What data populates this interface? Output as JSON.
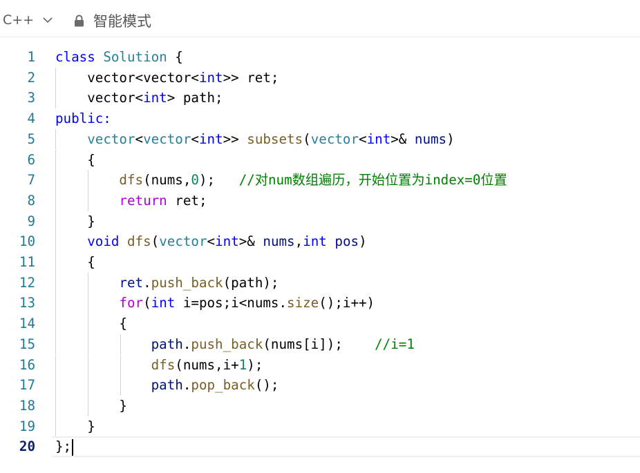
{
  "toolbar": {
    "language": "C++",
    "mode_label": "智能模式"
  },
  "editor": {
    "lines": [
      {
        "n": "1",
        "indent": 0,
        "tokens": [
          {
            "t": "class",
            "c": "#0000ff"
          },
          {
            "t": " "
          },
          {
            "t": "Solution",
            "c": "#267f99"
          },
          {
            "t": " {"
          }
        ]
      },
      {
        "n": "2",
        "indent": 1,
        "tokens": [
          {
            "t": "    vector<vector<"
          },
          {
            "t": "int",
            "c": "#0000ff"
          },
          {
            "t": ">> ret;"
          }
        ]
      },
      {
        "n": "3",
        "indent": 1,
        "tokens": [
          {
            "t": "    vector<"
          },
          {
            "t": "int",
            "c": "#0000ff"
          },
          {
            "t": "> path;"
          }
        ]
      },
      {
        "n": "4",
        "indent": 0,
        "tokens": [
          {
            "t": "public:",
            "c": "#0000ff"
          }
        ]
      },
      {
        "n": "5",
        "indent": 1,
        "tokens": [
          {
            "t": "    "
          },
          {
            "t": "vector",
            "c": "#267f99"
          },
          {
            "t": "<"
          },
          {
            "t": "vector",
            "c": "#267f99"
          },
          {
            "t": "<"
          },
          {
            "t": "int",
            "c": "#0000ff"
          },
          {
            "t": ">> "
          },
          {
            "t": "subsets",
            "c": "#795e26"
          },
          {
            "t": "("
          },
          {
            "t": "vector",
            "c": "#267f99"
          },
          {
            "t": "<"
          },
          {
            "t": "int",
            "c": "#0000ff"
          },
          {
            "t": ">& "
          },
          {
            "t": "nums",
            "c": "#001080"
          },
          {
            "t": ")"
          }
        ]
      },
      {
        "n": "6",
        "indent": 1,
        "tokens": [
          {
            "t": "    {"
          }
        ]
      },
      {
        "n": "7",
        "indent": 2,
        "tokens": [
          {
            "t": "        "
          },
          {
            "t": "dfs",
            "c": "#795e26"
          },
          {
            "t": "(nums,"
          },
          {
            "t": "0",
            "c": "#098658"
          },
          {
            "t": ");   "
          },
          {
            "t": "//对num数组遍历，开始位置为index=0位置",
            "c": "#008000"
          }
        ]
      },
      {
        "n": "8",
        "indent": 2,
        "tokens": [
          {
            "t": "        "
          },
          {
            "t": "return",
            "c": "#af00db"
          },
          {
            "t": " ret;"
          }
        ]
      },
      {
        "n": "9",
        "indent": 1,
        "tokens": [
          {
            "t": "    }"
          }
        ]
      },
      {
        "n": "10",
        "indent": 1,
        "tokens": [
          {
            "t": "    "
          },
          {
            "t": "void",
            "c": "#0000ff"
          },
          {
            "t": " "
          },
          {
            "t": "dfs",
            "c": "#795e26"
          },
          {
            "t": "("
          },
          {
            "t": "vector",
            "c": "#267f99"
          },
          {
            "t": "<"
          },
          {
            "t": "int",
            "c": "#0000ff"
          },
          {
            "t": ">& "
          },
          {
            "t": "nums",
            "c": "#001080"
          },
          {
            "t": ","
          },
          {
            "t": "int",
            "c": "#0000ff"
          },
          {
            "t": " "
          },
          {
            "t": "pos",
            "c": "#001080"
          },
          {
            "t": ")"
          }
        ]
      },
      {
        "n": "11",
        "indent": 1,
        "tokens": [
          {
            "t": "    {"
          }
        ]
      },
      {
        "n": "12",
        "indent": 2,
        "tokens": [
          {
            "t": "        "
          },
          {
            "t": "ret",
            "c": "#001080"
          },
          {
            "t": "."
          },
          {
            "t": "push_back",
            "c": "#795e26"
          },
          {
            "t": "(path);"
          }
        ]
      },
      {
        "n": "13",
        "indent": 2,
        "tokens": [
          {
            "t": "        "
          },
          {
            "t": "for",
            "c": "#af00db"
          },
          {
            "t": "("
          },
          {
            "t": "int",
            "c": "#0000ff"
          },
          {
            "t": " i=pos;i<nums."
          },
          {
            "t": "size",
            "c": "#795e26"
          },
          {
            "t": "();i++)"
          }
        ]
      },
      {
        "n": "14",
        "indent": 2,
        "tokens": [
          {
            "t": "        {"
          }
        ]
      },
      {
        "n": "15",
        "indent": 3,
        "tokens": [
          {
            "t": "            "
          },
          {
            "t": "path",
            "c": "#001080"
          },
          {
            "t": "."
          },
          {
            "t": "push_back",
            "c": "#795e26"
          },
          {
            "t": "(nums[i]);    "
          },
          {
            "t": "//i=1",
            "c": "#008000"
          }
        ]
      },
      {
        "n": "16",
        "indent": 3,
        "tokens": [
          {
            "t": "            "
          },
          {
            "t": "dfs",
            "c": "#795e26"
          },
          {
            "t": "(nums,i+"
          },
          {
            "t": "1",
            "c": "#098658"
          },
          {
            "t": ");"
          }
        ]
      },
      {
        "n": "17",
        "indent": 3,
        "tokens": [
          {
            "t": "            "
          },
          {
            "t": "path",
            "c": "#001080"
          },
          {
            "t": "."
          },
          {
            "t": "pop_back",
            "c": "#795e26"
          },
          {
            "t": "();"
          }
        ]
      },
      {
        "n": "18",
        "indent": 2,
        "tokens": [
          {
            "t": "        }"
          }
        ]
      },
      {
        "n": "19",
        "indent": 1,
        "tokens": [
          {
            "t": "    }"
          }
        ]
      },
      {
        "n": "20",
        "indent": 0,
        "current": true,
        "tokens": [
          {
            "t": "};"
          }
        ]
      }
    ]
  }
}
